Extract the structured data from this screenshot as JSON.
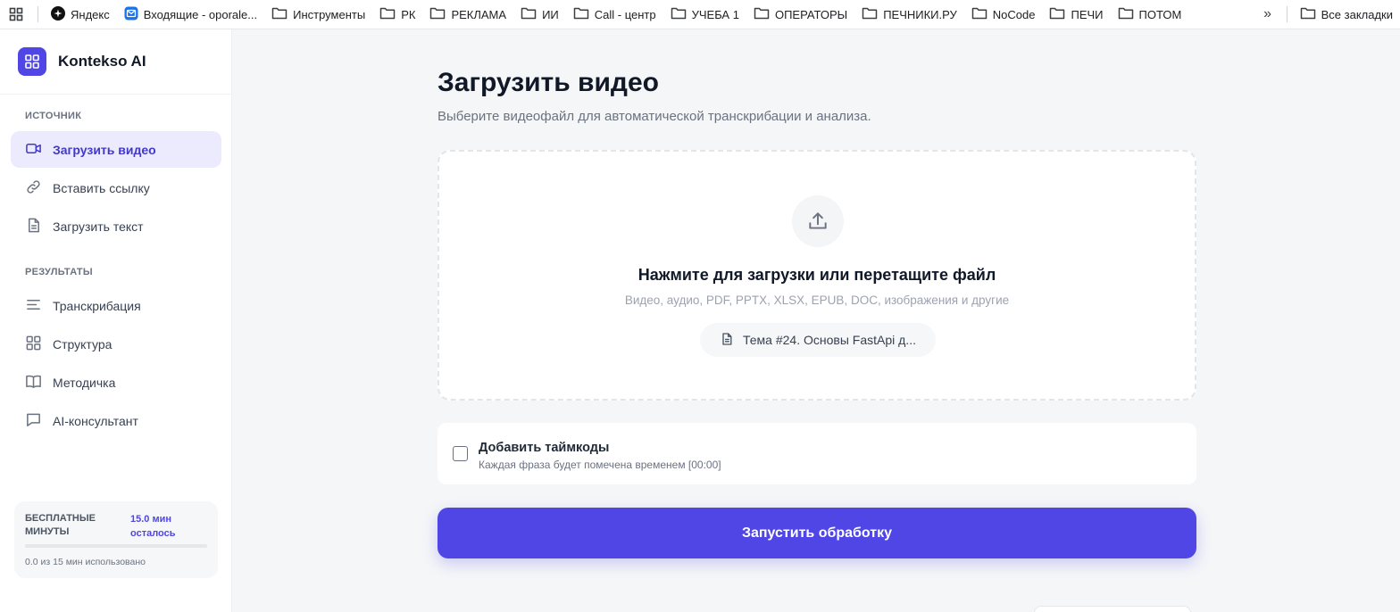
{
  "bookmarks": {
    "items": [
      {
        "label": "Яндекс",
        "icon": "yandex-icon"
      },
      {
        "label": "Входящие - oporale...",
        "icon": "mail-icon"
      },
      {
        "label": "Инструменты",
        "icon": "folder-icon"
      },
      {
        "label": "РК",
        "icon": "folder-icon"
      },
      {
        "label": "РЕКЛАМА",
        "icon": "folder-icon"
      },
      {
        "label": "ИИ",
        "icon": "folder-icon"
      },
      {
        "label": "Call - центр",
        "icon": "folder-icon"
      },
      {
        "label": "УЧЕБА 1",
        "icon": "folder-icon"
      },
      {
        "label": "ОПЕРАТОРЫ",
        "icon": "folder-icon"
      },
      {
        "label": "ПЕЧНИКИ.РУ",
        "icon": "folder-icon"
      },
      {
        "label": "NoCode",
        "icon": "folder-icon"
      },
      {
        "label": "ПЕЧИ",
        "icon": "folder-icon"
      },
      {
        "label": "ПОТОМ",
        "icon": "folder-icon"
      }
    ],
    "more": "»",
    "all_bookmarks": "Все закладки"
  },
  "sidebar": {
    "brand": "Kontekso AI",
    "section_source": "ИСТОЧНИК",
    "section_results": "РЕЗУЛЬТАТЫ",
    "source_items": [
      {
        "label": "Загрузить видео",
        "icon": "video-camera-icon",
        "active": true
      },
      {
        "label": "Вставить ссылку",
        "icon": "link-icon"
      },
      {
        "label": "Загрузить текст",
        "icon": "document-icon"
      }
    ],
    "result_items": [
      {
        "label": "Транскрибация",
        "icon": "lines-icon"
      },
      {
        "label": "Структура",
        "icon": "grid-icon"
      },
      {
        "label": "Методичка",
        "icon": "book-icon"
      },
      {
        "label": "AI-консультант",
        "icon": "chat-icon"
      }
    ],
    "free_minutes": {
      "title": "БЕСПЛАТНЫЕ МИНУТЫ",
      "remaining": "15.0 мин осталось",
      "used_text": "0.0 из 15 мин использовано",
      "used_fraction": 0
    }
  },
  "main": {
    "title": "Загрузить видео",
    "subtitle": "Выберите видеофайл для автоматической транскрибации и анализа.",
    "dropzone": {
      "title": "Нажмите для загрузки или перетащите файл",
      "types": "Видео, аудио, PDF, PPTX, XLSX, EPUB, DOC, изображения и другие",
      "file_name": "Тема #24. Основы FastApi д..."
    },
    "timecodes": {
      "label": "Добавить таймкоды",
      "hint": "Каждая фраза будет помечена временем [00:00]",
      "checked": false
    },
    "start_button": "Запустить обработку"
  },
  "colors": {
    "accent": "#4f46e5",
    "active_bg": "#eceafd",
    "background": "#f4f6f8"
  }
}
